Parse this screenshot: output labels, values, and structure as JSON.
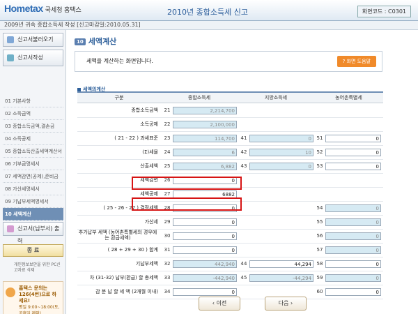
{
  "header": {
    "logo": "Hometax",
    "logo_sub": "국세청 홈택스",
    "title": "2010년 종합소득세 신고",
    "screen_code": "화면코드 : C0301"
  },
  "subheader": {
    "text": "2009년 귀속 종합소득세 작성 [신고마감일:2010.05.31]"
  },
  "sidebar": {
    "load_btn": "신고서불러오기",
    "write_btn": "신고서작성",
    "items": [
      "01 기본사항",
      "02 소득금액",
      "03 종합소득금액,결손금",
      "04 소득공제",
      "05 종합소득산출세액계산서",
      "06 기부금명세서",
      "07 세액감면(공제),준비금",
      "08 가산세명세서",
      "09 기납부세액명세서",
      "10 세액계산"
    ],
    "print_btn": "신고서(납부서) 출력",
    "end_btn": "종 료",
    "pc_delete": "개인정보보안을 위한 PC신고자료 삭제",
    "help_text": "홈택스 문의는 126(4번)으로 하세요!",
    "help_hours": "평일 9:00~18:00(토,공휴일 제외)"
  },
  "main": {
    "section_num": "10",
    "section_title": "세액계산",
    "info_text": "세액을 계산하는 화면입니다.",
    "help_button": "? 화면 도움말",
    "table_title": "세액의계산",
    "col_headers": [
      "구분",
      "종합소득세",
      "지방소득세",
      "농어촌특별세"
    ],
    "rows": [
      {
        "label": "종합소득금액",
        "c1": "21",
        "v1": "2,214,700",
        "c2": "",
        "v2": "",
        "c3": "",
        "v3": ""
      },
      {
        "label": "소득공제",
        "c1": "22",
        "v1": "2,100,000",
        "c2": "",
        "v2": "",
        "c3": "",
        "v3": ""
      },
      {
        "label": "( 21 - 22 ) 과세표준",
        "c1": "23",
        "v1": "114,700",
        "c2": "41",
        "v2": "0",
        "c3": "51",
        "v3": "0"
      },
      {
        "label": "(Σ)세율",
        "c1": "24",
        "v1": "6",
        "c2": "42",
        "v2": "10",
        "c3": "52",
        "v3": "0"
      },
      {
        "label": "산출세액",
        "c1": "25",
        "v1": "6,882",
        "c2": "43",
        "v2": "0",
        "c3": "53",
        "v3": "0"
      },
      {
        "label": "세액감면",
        "c1": "26",
        "v1": "0",
        "c2": "",
        "v2": "",
        "c3": "",
        "v3": ""
      },
      {
        "label": "세액공제",
        "c1": "27",
        "v1": "6882",
        "c2": "",
        "v2": "",
        "c3": "",
        "v3": ""
      },
      {
        "label": "( 25 - 26 - 27 ) 결정세액",
        "c1": "28",
        "v1": "0",
        "c2": "",
        "v2": "",
        "c3": "54",
        "v3": "0"
      },
      {
        "label": "가산세",
        "c1": "29",
        "v1": "0",
        "c2": "",
        "v2": "",
        "c3": "55",
        "v3": "0"
      },
      {
        "label": "추가납부 세액 (농어촌특별세의 경우에는 환급세액)",
        "c1": "30",
        "v1": "0",
        "c2": "",
        "v2": "",
        "c3": "56",
        "v3": "0"
      },
      {
        "label": "( 28 + 29 + 30 ) 합계",
        "c1": "31",
        "v1": "0",
        "c2": "",
        "v2": "",
        "c3": "57",
        "v3": "0"
      },
      {
        "label": "기납부세액",
        "c1": "32",
        "v1": "442,940",
        "c2": "44",
        "v2": "44,294",
        "c3": "58",
        "v3": "0"
      },
      {
        "label": "차 (31-32) 납부(환급) 할 총세액",
        "c1": "33",
        "v1": "-442,940",
        "c2": "45",
        "v2": "-44,294",
        "c3": "59",
        "v3": "0"
      },
      {
        "label": "감 분 납 할 세 액 (2개월 이내)",
        "c1": "34",
        "v1": "0",
        "c2": "",
        "v2": "",
        "c3": "60",
        "v3": "0"
      }
    ]
  },
  "footer": {
    "prev": "‹ 이전",
    "next": "다음 ›"
  }
}
